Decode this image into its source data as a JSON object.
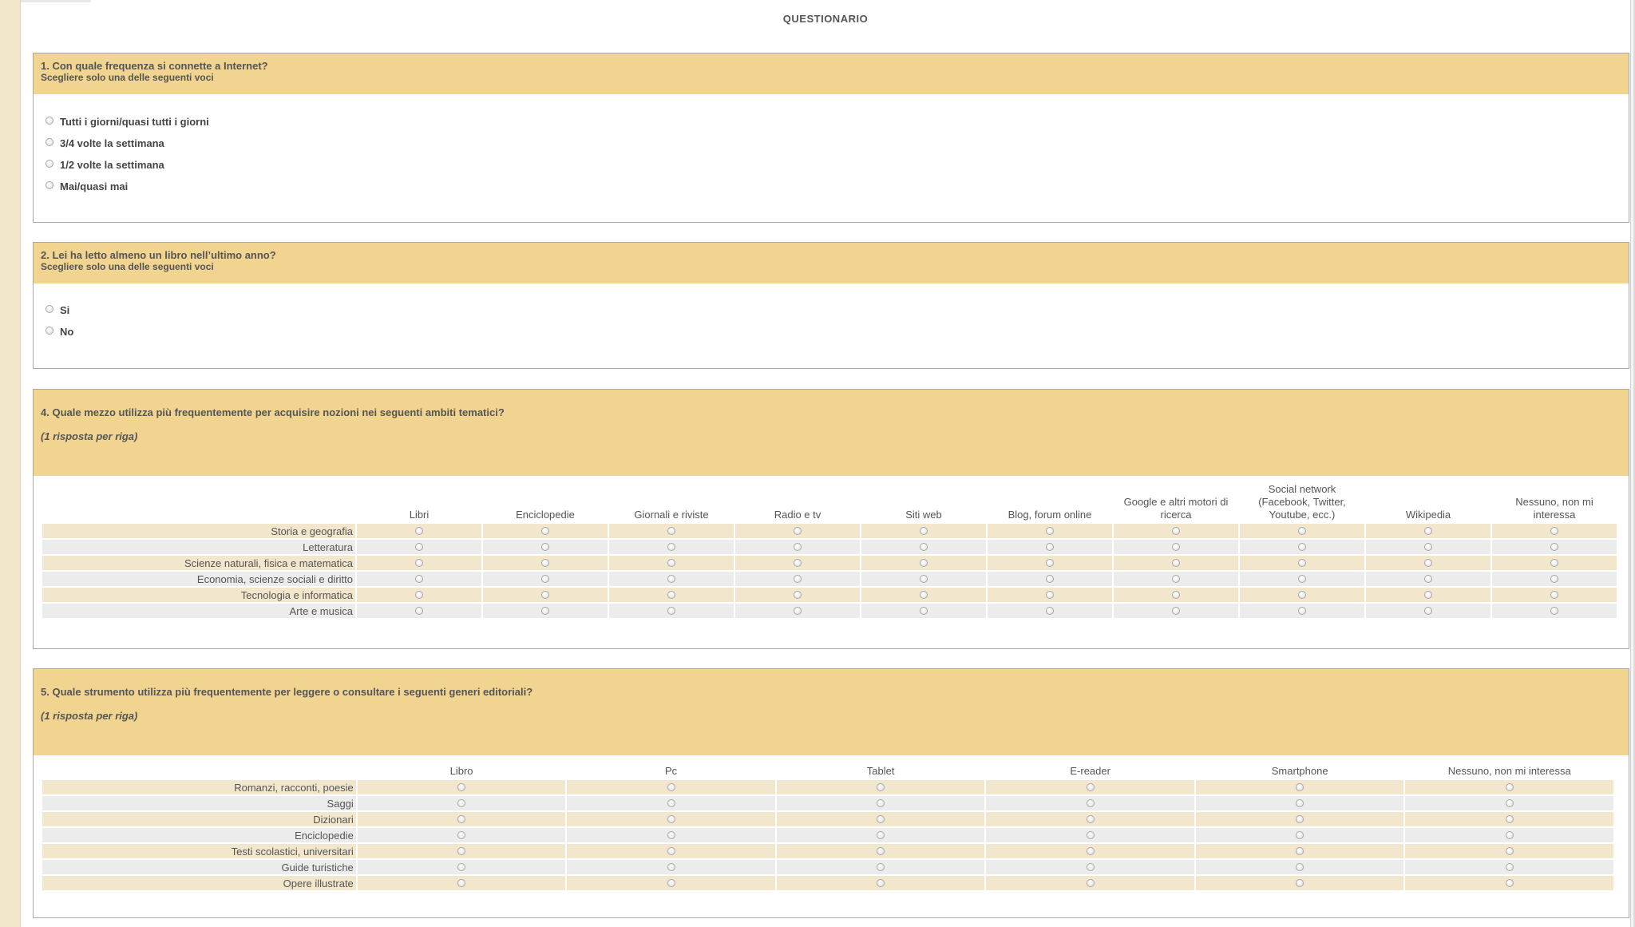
{
  "page": {
    "title": "QUESTIONARIO"
  },
  "q1": {
    "title": "1. Con quale frequenza si connette a Internet?",
    "subtitle": "Scegliere solo una delle seguenti voci",
    "options": [
      "Tutti i giorni/quasi tutti i giorni",
      "3/4 volte la settimana",
      "1/2 volte la settimana",
      "Mai/quasi mai"
    ]
  },
  "q2": {
    "title": "2. Lei ha letto almeno un libro nell’ultimo anno?",
    "subtitle": "Scegliere solo una delle seguenti voci",
    "options": [
      "Si",
      "No"
    ]
  },
  "q4": {
    "title": "4. Quale mezzo utilizza più frequentemente per acquisire nozioni nei seguenti ambiti tematici?",
    "note": "(1 risposta per riga)",
    "columns": [
      "Libri",
      "Enciclopedie",
      "Giornali e riviste",
      "Radio e tv",
      "Siti web",
      "Blog, forum online",
      "Google e altri motori di ricerca",
      "Social network (Facebook, Twitter, Youtube, ecc.)",
      "Wikipedia",
      "Nessuno, non mi interessa"
    ],
    "rows": [
      "Storia e geografia",
      "Letteratura",
      "Scienze naturali, fisica e matematica",
      "Economia, scienze sociali e diritto",
      "Tecnologia e informatica",
      "Arte e musica"
    ]
  },
  "q5": {
    "title": "5. Quale strumento utilizza più frequentemente per leggere o consultare i seguenti generi editoriali?",
    "note": "(1 risposta per riga)",
    "columns": [
      "Libro",
      "Pc",
      "Tablet",
      "E-reader",
      "Smartphone",
      "Nessuno, non mi interessa"
    ],
    "rows": [
      "Romanzi, racconti, poesie",
      "Saggi",
      "Dizionari",
      "Enciclopedie",
      "Testi scolastici, universitari",
      "Guide turistiche",
      "Opere illustrate"
    ]
  }
}
